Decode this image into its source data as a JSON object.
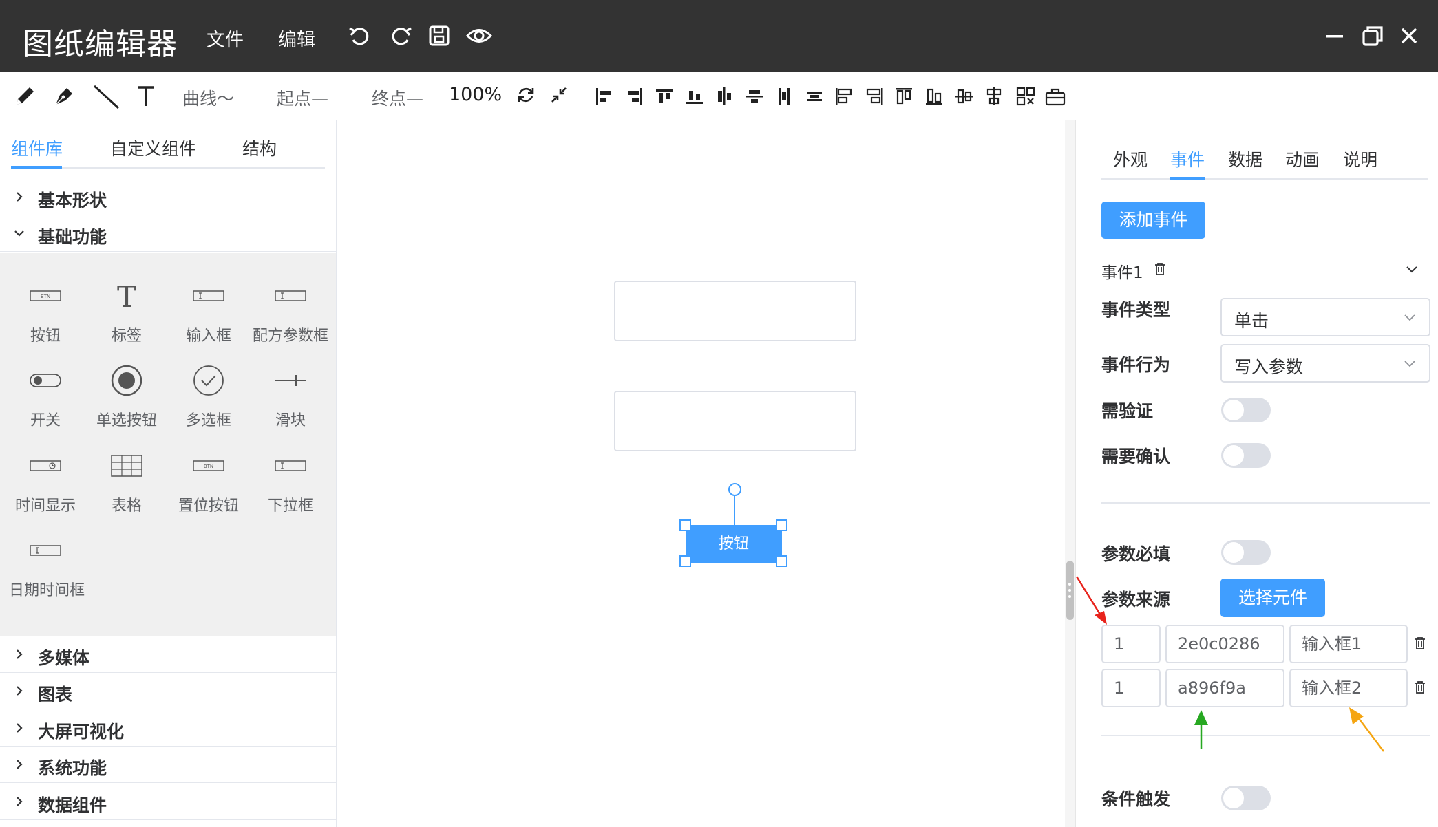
{
  "app": {
    "title": "图纸编辑器",
    "menu": [
      "文件",
      "编辑"
    ],
    "header_icons": [
      "undo-icon",
      "redo-icon",
      "save-icon",
      "preview-eye-icon"
    ],
    "window_controls": [
      "minimize-icon",
      "restore-icon",
      "close-icon"
    ]
  },
  "toolbar": {
    "draw_tools": [
      "pencil-icon",
      "pen-icon",
      "line-icon",
      "text-tool-icon"
    ],
    "curve_label": "曲线～",
    "start_label": "起点—",
    "end_label": "终点—",
    "zoom_label": "100%",
    "align_icons": [
      "align-left-icon",
      "align-right-icon",
      "align-top-icon",
      "align-bottom-icon",
      "align-hcenter-icon",
      "align-vcenter-icon",
      "distribute-h-icon",
      "distribute-v-icon",
      "same-width-icon",
      "same-height-icon",
      "group-top-icon",
      "group-bottom-icon",
      "group-hcenter-icon",
      "group-vcenter-icon",
      "ungroup-icon",
      "toolbox-icon"
    ]
  },
  "left_panel": {
    "tabs": [
      "组件库",
      "自定义组件",
      "结构"
    ],
    "active_tab": 0,
    "categories_top": [
      {
        "label": "基本形状",
        "expanded": false
      },
      {
        "label": "基础功能",
        "expanded": true
      }
    ],
    "components": [
      {
        "label": "按钮",
        "icon": "button-icon"
      },
      {
        "label": "标签",
        "icon": "label-icon"
      },
      {
        "label": "输入框",
        "icon": "input-icon"
      },
      {
        "label": "配方参数框",
        "icon": "recipe-param-icon"
      },
      {
        "label": "开关",
        "icon": "switch-icon"
      },
      {
        "label": "单选按钮",
        "icon": "radio-icon"
      },
      {
        "label": "多选框",
        "icon": "checkbox-icon"
      },
      {
        "label": "滑块",
        "icon": "slider-icon"
      },
      {
        "label": "时间显示",
        "icon": "time-display-icon"
      },
      {
        "label": "表格",
        "icon": "table-icon"
      },
      {
        "label": "置位按钮",
        "icon": "set-button-icon"
      },
      {
        "label": "下拉框",
        "icon": "dropdown-icon"
      },
      {
        "label": "日期时间框",
        "icon": "datetime-icon"
      }
    ],
    "categories_bottom": [
      {
        "label": "多媒体",
        "expanded": false
      },
      {
        "label": "图表",
        "expanded": false
      },
      {
        "label": "大屏可视化",
        "expanded": false
      },
      {
        "label": "系统功能",
        "expanded": false
      },
      {
        "label": "数据组件",
        "expanded": false
      }
    ]
  },
  "canvas": {
    "button_text": "按钮"
  },
  "right_panel": {
    "tabs": [
      "外观",
      "事件",
      "数据",
      "动画",
      "说明"
    ],
    "active_tab": 1,
    "add_event_label": "添加事件",
    "event_title": "事件1",
    "event_type_label": "事件类型",
    "event_type_value": "单击",
    "event_action_label": "事件行为",
    "event_action_value": "写入参数",
    "need_verify_label": "需验证",
    "need_verify_on": false,
    "need_confirm_label": "需要确认",
    "need_confirm_on": false,
    "param_required_label": "参数必填",
    "param_required_on": false,
    "param_source_label": "参数来源",
    "select_element_label": "选择元件",
    "params": [
      {
        "index": "1",
        "id": "2e0c0286",
        "name": "输入框1"
      },
      {
        "index": "1",
        "id": "a896f9a",
        "name": "输入框2"
      }
    ],
    "condition_trigger_label": "条件触发",
    "condition_trigger_on": false
  },
  "colors": {
    "titlebar": "#333333",
    "accent": "#409eff",
    "palette_bg": "#f0f0f0",
    "annotation_red": "#e8231c",
    "annotation_green": "#27a821",
    "annotation_orange": "#f5a511"
  }
}
